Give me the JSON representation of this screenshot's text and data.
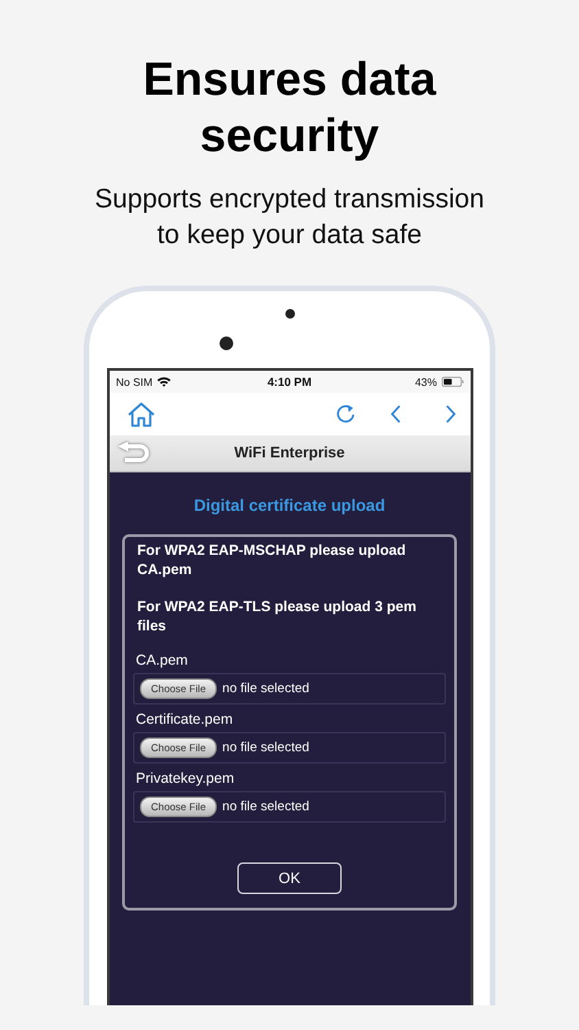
{
  "headline": "Ensures data security",
  "subtitle": "Supports encrypted transmission to keep your data safe",
  "status_bar": {
    "carrier": "No SIM",
    "time": "4:10 PM",
    "battery": "43%"
  },
  "title_bar": {
    "title": "WiFi Enterprise"
  },
  "heading": "Digital certificate upload",
  "notes": [
    "For WPA2 EAP-MSCHAP please upload CA.pem",
    "For WPA2 EAP-TLS please upload 3 pem files"
  ],
  "files": [
    {
      "label": "CA.pem",
      "button": "Choose File",
      "status": "no file selected"
    },
    {
      "label": "Certificate.pem",
      "button": "Choose File",
      "status": "no file selected"
    },
    {
      "label": "Privatekey.pem",
      "button": "Choose File",
      "status": "no file selected"
    }
  ],
  "ok_button": "OK"
}
